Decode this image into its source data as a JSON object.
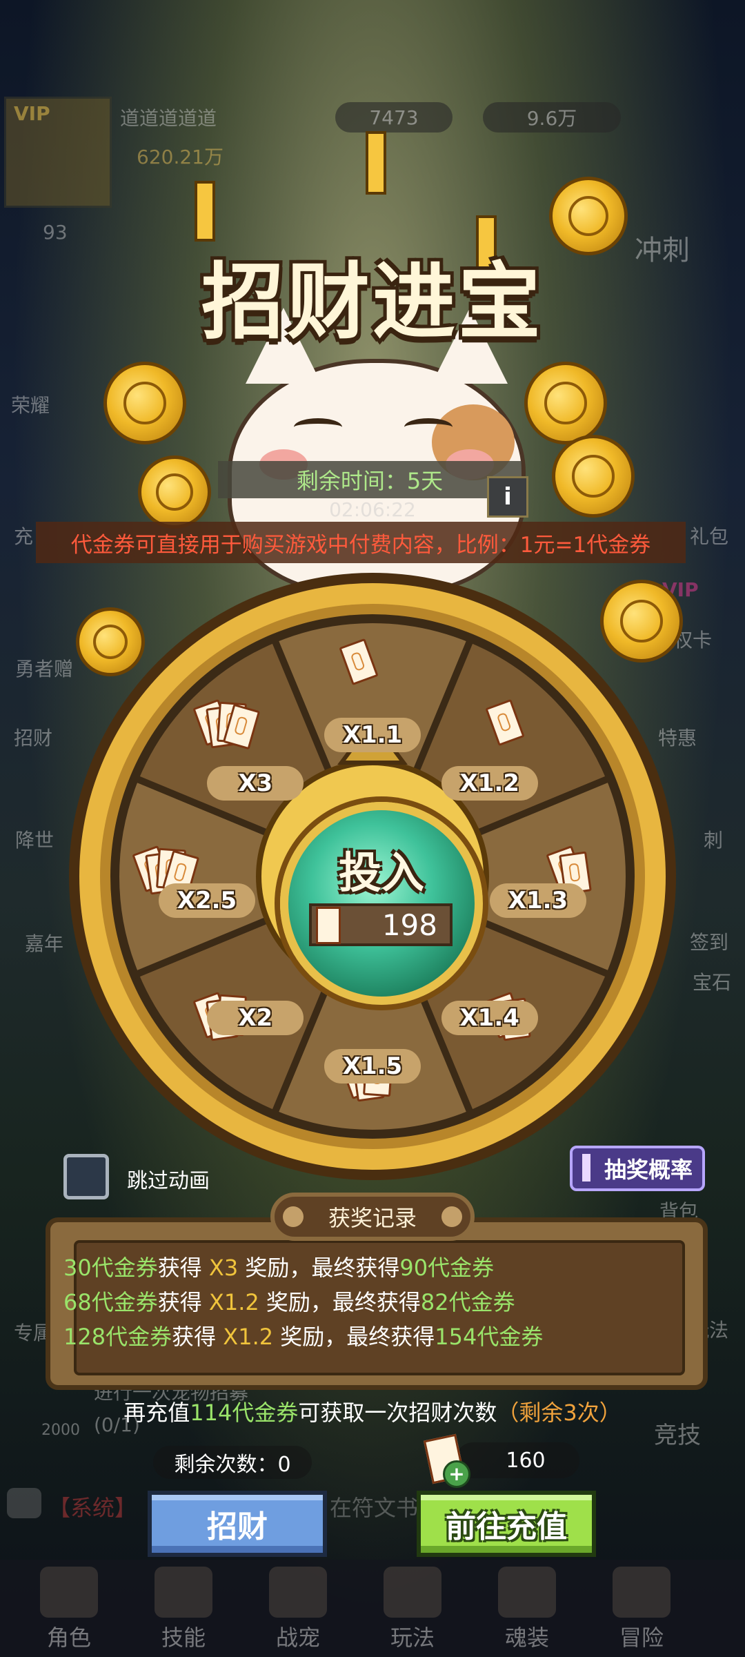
{
  "hud": {
    "player_name": "道道道道道",
    "vip_label": "VIP",
    "power": "620.21万",
    "level": "93",
    "gems": "7473",
    "gold": "9.6万"
  },
  "side_labels": {
    "left": [
      "荣耀",
      "充",
      "勇者赠",
      "招财",
      "降世",
      "嘉年"
    ],
    "right": [
      "冲刺",
      "礼包",
      "VIP",
      "权卡",
      "特惠",
      "刺",
      "签到",
      "宝石",
      "背包",
      "玩法",
      "竞技"
    ],
    "left_lower": [
      "专属"
    ]
  },
  "event": {
    "title": "招财进宝",
    "time_label": "剩余时间：5天",
    "time_sub": "02:06:22",
    "info_icon": "info-icon",
    "notice": "代金券可直接用于购买游戏中付费内容，比例：1元=1代金券"
  },
  "wheel": {
    "segments": [
      {
        "label": "X1.1"
      },
      {
        "label": "X1.2"
      },
      {
        "label": "X1.3"
      },
      {
        "label": "X1.4"
      },
      {
        "label": "X1.5"
      },
      {
        "label": "X2"
      },
      {
        "label": "X2.5"
      },
      {
        "label": "X3"
      }
    ],
    "center_label": "投入",
    "center_cost": "198"
  },
  "controls": {
    "skip_label": "跳过动画",
    "skip_checked": false,
    "probability_button": "抽奖概率"
  },
  "records": {
    "tab_label": "获奖记录",
    "rows": [
      {
        "amount": "30代金券",
        "got": "获得",
        "mult": "X3",
        "reward": " 奖励，最终获得",
        "final": "90代金券"
      },
      {
        "amount": "68代金券",
        "got": "获得",
        "mult": "X1.2",
        "reward": " 奖励，最终获得",
        "final": "82代金券"
      },
      {
        "amount": "128代金券",
        "got": "获得",
        "mult": "X1.2",
        "reward": " 奖励，最终获得",
        "final": "154代金券"
      }
    ]
  },
  "recharge": {
    "prefix": "再充值",
    "amount": "114代金券",
    "suffix": "可获取一次招财次数",
    "remaining": "（剩余3次）"
  },
  "remain_count": "剩余次数：0",
  "ticket_count": "160",
  "buttons": {
    "spin": "招财",
    "goto_recharge": "前往充值"
  },
  "chat": {
    "system": "【系统】",
    "text": "在符文书"
  },
  "bottom_nav": [
    "角色",
    "技能",
    "战宠",
    "玩法",
    "魂装",
    "冒险"
  ],
  "background_task": {
    "text": "进行一次宠物招募",
    "progress": "(0/1)",
    "reward": "2000"
  },
  "colors": {
    "record_green": "#9ae46a",
    "record_yellow": "#f0c43c",
    "notice_red": "#ff5a3c",
    "remaining_orange": "#f0a23c",
    "spin_button": "#6f9ee0",
    "recharge_button": "#9fe04a"
  }
}
